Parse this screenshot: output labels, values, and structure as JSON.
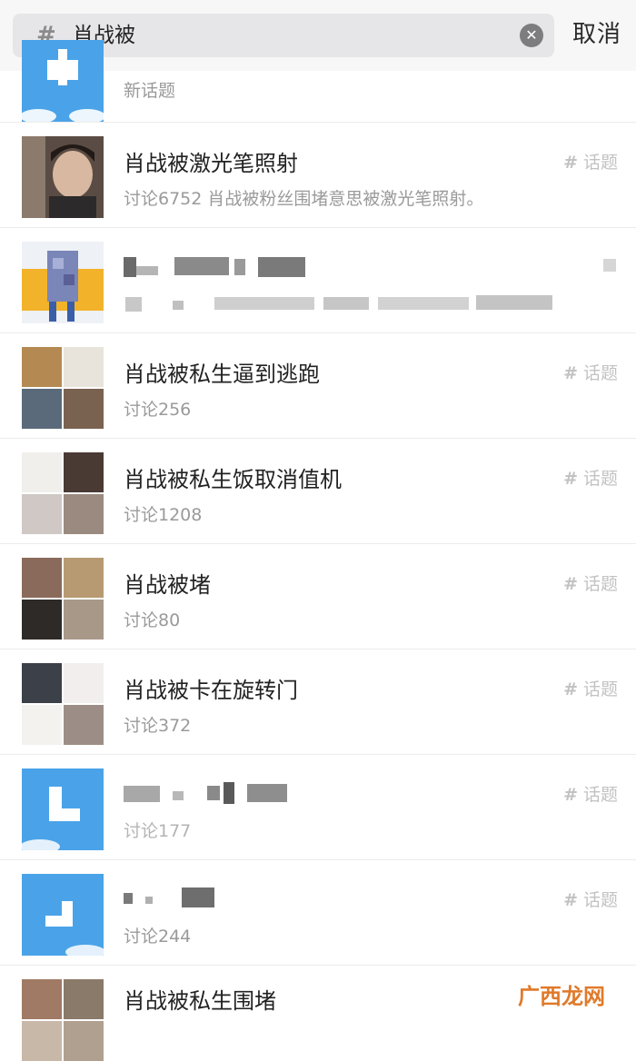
{
  "search": {
    "query": "肖战被",
    "hash_icon": "#-icon",
    "clear_icon": "clear-icon",
    "cancel_label": "取消"
  },
  "results": [
    {
      "title": "",
      "subtitle": "新话题",
      "tag": ""
    },
    {
      "title": "肖战被激光笔照射",
      "subtitle": "讨论6752 肖战被粉丝围堵意思被激光笔照射。",
      "tag": "话题"
    },
    {
      "title": "",
      "subtitle": "",
      "tag": ""
    },
    {
      "title": "肖战被私生逼到逃跑",
      "subtitle": "讨论256",
      "tag": "话题"
    },
    {
      "title": "肖战被私生饭取消值机",
      "subtitle": "讨论1208",
      "tag": "话题"
    },
    {
      "title": "肖战被堵",
      "subtitle": "讨论80",
      "tag": "话题"
    },
    {
      "title": "肖战被卡在旋转门",
      "subtitle": "讨论372",
      "tag": "话题"
    },
    {
      "title": "",
      "subtitle": "讨论177",
      "tag": "话题"
    },
    {
      "title": "",
      "subtitle": "讨论244",
      "tag": "话题"
    },
    {
      "title": "肖战被私生围堵",
      "subtitle": "",
      "tag": ""
    }
  ],
  "watermark": "广西龙网",
  "colors": {
    "topic_blue": "#4aa3e8",
    "tag_gray": "#c2c2c2",
    "watermark_orange": "#e07a2a"
  }
}
